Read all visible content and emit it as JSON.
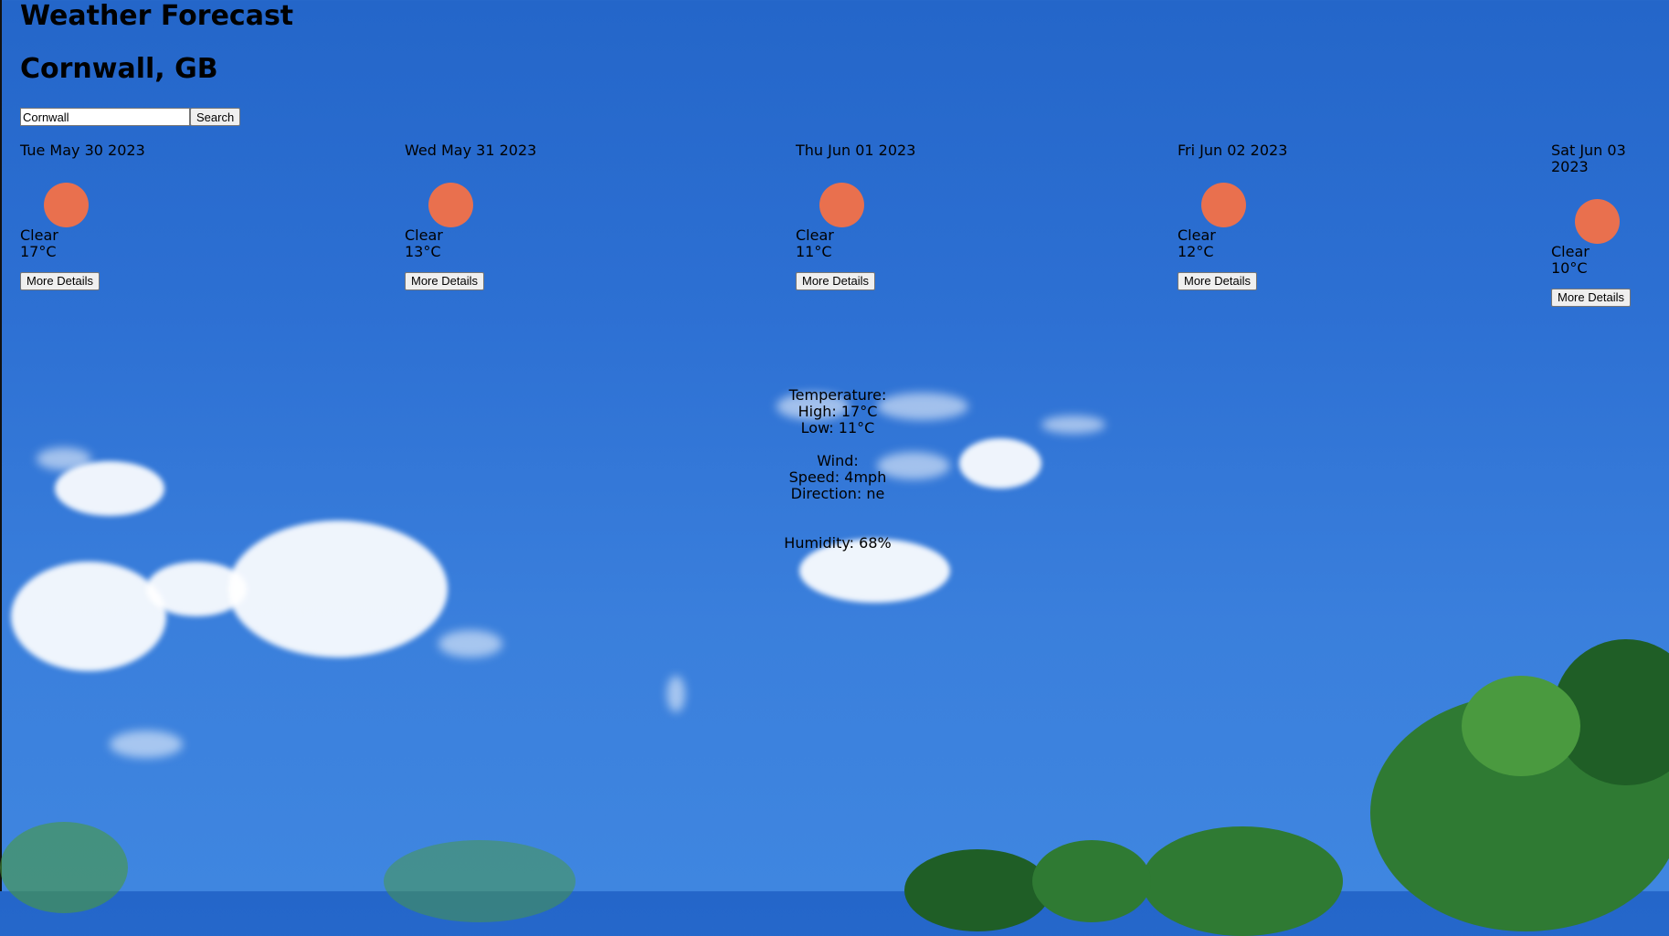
{
  "header": {
    "title": "Weather Forecast",
    "location": "Cornwall, GB"
  },
  "search": {
    "value": "Cornwall",
    "button_label": "Search"
  },
  "days": [
    {
      "date": "Tue May 30 2023",
      "condition": "Clear",
      "temp": "17°C",
      "button_label": "More Details"
    },
    {
      "date": "Wed May 31 2023",
      "condition": "Clear",
      "temp": "13°C",
      "button_label": "More Details"
    },
    {
      "date": "Thu Jun 01 2023",
      "condition": "Clear",
      "temp": "11°C",
      "button_label": "More Details"
    },
    {
      "date": "Fri Jun 02 2023",
      "condition": "Clear",
      "temp": "12°C",
      "button_label": "More Details"
    },
    {
      "date": "Sat Jun 03 2023",
      "condition": "Clear",
      "temp": "10°C",
      "button_label": "More Details"
    }
  ],
  "details": {
    "temperature_heading": "Temperature:",
    "high": "High: 17°C",
    "low": "Low: 11°C",
    "wind_heading": "Wind:",
    "speed": "Speed: 4mph",
    "direction": "Direction: ne",
    "humidity": "Humidity: 68%"
  },
  "colors": {
    "sky": "#2d70d3",
    "sun_icon": "#e9704e"
  },
  "icons": {
    "weather": "sun-icon"
  }
}
